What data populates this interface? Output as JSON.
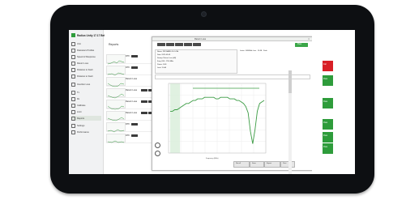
{
  "app": {
    "title": "Radius Unity 17.17 Beta"
  },
  "sidebar": {
    "items": [
      {
        "label": "Unit"
      },
      {
        "label": "Diameters Profiles"
      },
      {
        "label": "Speed of Response"
      },
      {
        "label": "Return Loss"
      },
      {
        "label": "Distance to Fault"
      },
      {
        "label": "Distance to Fault"
      },
      {
        "label": "Insertion Loss"
      },
      {
        "label": "Tx"
      },
      {
        "label": "Rx"
      },
      {
        "label": "Calibrate"
      },
      {
        "label": "Limit"
      },
      {
        "label": "Reports"
      },
      {
        "label": "Settings"
      },
      {
        "label": "Performance"
      }
    ]
  },
  "reports": {
    "title": "Reports",
    "rows": [
      {
        "label": "DTF"
      },
      {
        "label": "DTF"
      },
      {
        "label": "Return Loss"
      },
      {
        "label": "Return Loss"
      },
      {
        "label": "Return Loss"
      },
      {
        "label": "Return Loss"
      },
      {
        "label": "DTF"
      },
      {
        "label": "DTF"
      }
    ]
  },
  "dialog": {
    "title": "Return Loss",
    "close": "×",
    "pass_label": "Pass",
    "info": [
      "Name: ZBT-BAND-20-1-CAL",
      "Date: 2021-03-09",
      "Sweep: Return Loss (dB)",
      "Freq: 698 - 2700 MHz",
      "Points: 1001",
      "Limit: 15 dB"
    ],
    "info_right": "Limits: 1690MHz Low · 19.4B · Peak",
    "footer_buttons": [
      "Recall",
      "Save",
      "Export",
      "Print"
    ],
    "x_axis_label": "Frequency (MHz)"
  },
  "status_panel": {
    "buttons": [
      {
        "label": "Fail",
        "color": "#d81f26"
      },
      {
        "label": "Pass",
        "color": "#2e9c3b"
      },
      {
        "label": "Pass",
        "color": "#2e9c3b"
      },
      {
        "label": "Pass",
        "color": "#2e9c3b"
      },
      {
        "label": "Pass",
        "color": "#2e9c3b"
      },
      {
        "label": "Pass",
        "color": "#2e9c3b"
      }
    ]
  },
  "colors": {
    "accent": "#3ba648",
    "fail": "#d81f26",
    "trace": "#3a9b43"
  },
  "chart_data": {
    "type": "line",
    "series": [
      {
        "values": [
          18,
          18,
          17,
          17,
          16,
          15,
          14,
          13,
          13,
          12,
          11,
          11,
          10,
          10,
          10,
          9,
          9,
          9,
          9,
          9,
          10,
          10,
          9,
          9,
          9,
          9,
          10,
          10,
          10,
          11,
          11,
          12,
          13,
          15,
          19,
          31,
          39,
          30,
          18,
          13,
          12,
          11
        ]
      }
    ],
    "grid": true
  }
}
